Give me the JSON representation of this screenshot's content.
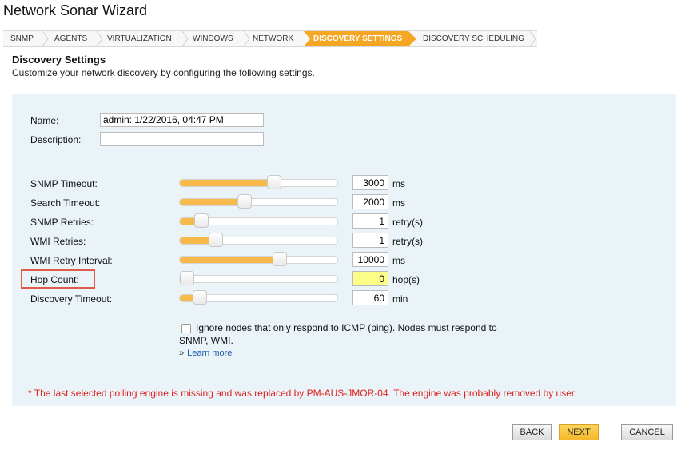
{
  "window": {
    "title": "Network Sonar Wizard"
  },
  "tabs": [
    {
      "label": "SNMP",
      "active": false
    },
    {
      "label": "AGENTS",
      "active": false
    },
    {
      "label": "VIRTUALIZATION",
      "active": false
    },
    {
      "label": "WINDOWS",
      "active": false
    },
    {
      "label": "NETWORK",
      "active": false
    },
    {
      "label": "DISCOVERY SETTINGS",
      "active": true
    },
    {
      "label": "DISCOVERY SCHEDULING",
      "active": false
    }
  ],
  "header": {
    "title": "Discovery Settings",
    "subtitle": "Customize your network discovery by configuring the following settings."
  },
  "form": {
    "name_label": "Name:",
    "name_value": "admin: 1/22/2016, 04:47 PM",
    "description_label": "Description:",
    "description_value": ""
  },
  "settings": [
    {
      "label": "SNMP Timeout:",
      "value": "3000",
      "unit": "ms",
      "slider_fraction": 0.6
    },
    {
      "label": "Search Timeout:",
      "value": "2000",
      "unit": "ms",
      "slider_fraction": 0.4
    },
    {
      "label": "SNMP Retries:",
      "value": "1",
      "unit": "retry(s)",
      "slider_fraction": 0.1
    },
    {
      "label": "WMI Retries:",
      "value": "1",
      "unit": "retry(s)",
      "slider_fraction": 0.2
    },
    {
      "label": "WMI Retry Interval:",
      "value": "10000",
      "unit": "ms",
      "slider_fraction": 0.64
    },
    {
      "label": "Hop Count:",
      "value": "0",
      "unit": "hop(s)",
      "slider_fraction": 0.0,
      "highlighted": true
    },
    {
      "label": "Discovery Timeout:",
      "value": "60",
      "unit": "min",
      "slider_fraction": 0.09
    }
  ],
  "options": {
    "ignore_icmp_checked": false,
    "ignore_icmp_line1": "Ignore nodes that only respond to ICMP (ping). Nodes must respond to",
    "ignore_icmp_line2": "SNMP, WMI.",
    "learn_more_arrow": "»",
    "learn_more": "Learn more"
  },
  "warning": "* The last selected polling engine is missing and was replaced by PM-AUS-JMOR-04. The engine was probably removed by user.",
  "buttons": {
    "back": "BACK",
    "next": "NEXT",
    "cancel": "CANCEL"
  },
  "colors": {
    "accent": "#f5a623",
    "slider_fill": "#f6b94a",
    "panel_bg": "#eaf3f8",
    "warning": "#e0201b",
    "highlight": "#fdfd8a"
  }
}
